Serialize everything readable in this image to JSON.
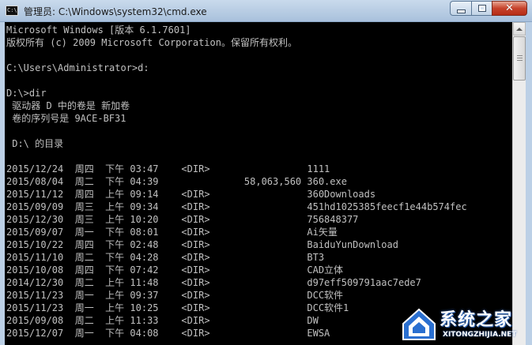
{
  "window": {
    "title": "管理员: C:\\Windows\\system32\\cmd.exe",
    "icon_label": "C:\\"
  },
  "console": {
    "header": [
      "Microsoft Windows [版本 6.1.7601]",
      "版权所有 (c) 2009 Microsoft Corporation。保留所有权利。",
      "",
      "C:\\Users\\Administrator>d:",
      "",
      "D:\\>dir",
      " 驱动器 D 中的卷是 新加卷",
      " 卷的序列号是 9ACE-BF31",
      "",
      " D:\\ 的目录",
      ""
    ],
    "entries": [
      {
        "date": "2015/12/24",
        "weekday": "周四",
        "ampm": "下午",
        "time": "03:47",
        "type": "<DIR>",
        "size": "",
        "name": "1111"
      },
      {
        "date": "2015/08/04",
        "weekday": "周二",
        "ampm": "下午",
        "time": "04:39",
        "type": "",
        "size": "58,063,560",
        "name": "360.exe"
      },
      {
        "date": "2015/11/12",
        "weekday": "周四",
        "ampm": "上午",
        "time": "09:14",
        "type": "<DIR>",
        "size": "",
        "name": "360Downloads"
      },
      {
        "date": "2015/09/09",
        "weekday": "周三",
        "ampm": "上午",
        "time": "09:34",
        "type": "<DIR>",
        "size": "",
        "name": "451hd1025385feecf1e44b574fec"
      },
      {
        "date": "2015/12/30",
        "weekday": "周三",
        "ampm": "上午",
        "time": "10:20",
        "type": "<DIR>",
        "size": "",
        "name": "756848377"
      },
      {
        "date": "2015/09/07",
        "weekday": "周一",
        "ampm": "下午",
        "time": "08:01",
        "type": "<DIR>",
        "size": "",
        "name": "Ai矢量"
      },
      {
        "date": "2015/10/22",
        "weekday": "周四",
        "ampm": "下午",
        "time": "02:48",
        "type": "<DIR>",
        "size": "",
        "name": "BaiduYunDownload"
      },
      {
        "date": "2015/11/10",
        "weekday": "周二",
        "ampm": "下午",
        "time": "04:28",
        "type": "<DIR>",
        "size": "",
        "name": "BT3"
      },
      {
        "date": "2015/10/08",
        "weekday": "周四",
        "ampm": "下午",
        "time": "07:42",
        "type": "<DIR>",
        "size": "",
        "name": "CAD立体"
      },
      {
        "date": "2014/12/30",
        "weekday": "周二",
        "ampm": "上午",
        "time": "11:48",
        "type": "<DIR>",
        "size": "",
        "name": "d97eff509791aac7ede7"
      },
      {
        "date": "2015/11/23",
        "weekday": "周一",
        "ampm": "上午",
        "time": "09:37",
        "type": "<DIR>",
        "size": "",
        "name": "DCC软件"
      },
      {
        "date": "2015/11/23",
        "weekday": "周一",
        "ampm": "上午",
        "time": "10:25",
        "type": "<DIR>",
        "size": "",
        "name": "DCC软件1"
      },
      {
        "date": "2015/09/08",
        "weekday": "周二",
        "ampm": "上午",
        "time": "11:33",
        "type": "<DIR>",
        "size": "",
        "name": "DW"
      },
      {
        "date": "2015/12/07",
        "weekday": "周一",
        "ampm": "下午",
        "time": "04:08",
        "type": "<DIR>",
        "size": "",
        "name": "EWSA"
      }
    ]
  },
  "colors": {
    "console_background": "#000000",
    "console_text": "#c0c0c0",
    "close_button": "#c7432c",
    "frame": "#bcd0e6"
  },
  "icons": {
    "app": "console-icon",
    "minimize": "minimize-icon",
    "maximize": "maximize-icon",
    "close": "close-icon",
    "scroll_up": "arrow-up-icon"
  },
  "watermark": {
    "name": "系统之家",
    "domain": "XITONGZHIJIA.NET"
  }
}
